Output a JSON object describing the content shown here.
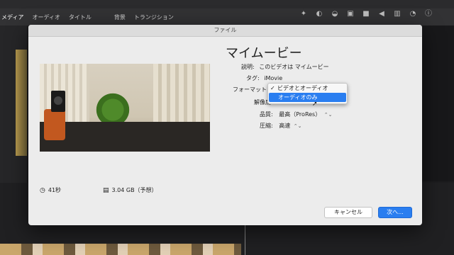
{
  "app": {
    "tabs": [
      "メディア",
      "オーディオ",
      "タイトル",
      "背景",
      "トランジション"
    ],
    "active_tab": "メディア"
  },
  "dialog": {
    "window_title": "ファイル",
    "project_title": "マイムービー",
    "description_label": "説明:",
    "description_value": "このビデオは マイムービー",
    "tag_label": "タグ:",
    "tag_value": "iMovie",
    "format_label": "フォーマット",
    "resolution_label": "解像度",
    "format_options": [
      {
        "label": "ビデオとオーディオ",
        "checked": true,
        "highlighted": false
      },
      {
        "label": "オーディオのみ",
        "checked": false,
        "highlighted": true
      }
    ],
    "quality_label": "品質:",
    "quality_value": "最高（ProRes）",
    "compress_label": "圧縮:",
    "compress_value": "高速",
    "duration": "41秒",
    "file_size": "3.04 GB（予想）",
    "cancel_label": "キャンセル",
    "next_label": "次へ...",
    "accent_color": "#2a7ef0"
  },
  "icons": {
    "stepper": "⌃⌄",
    "clock": "🕒",
    "file": "📄"
  }
}
